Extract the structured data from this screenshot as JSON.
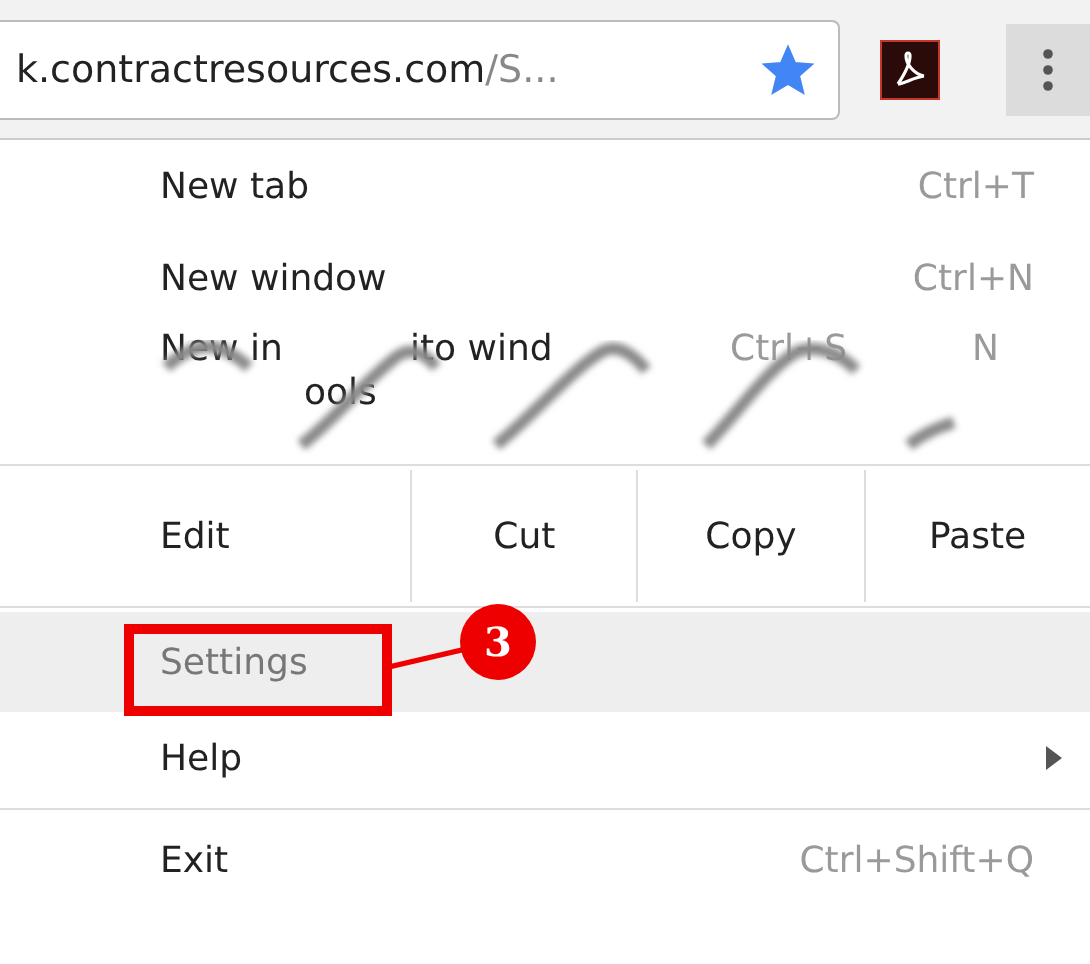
{
  "address_bar": {
    "host": "k.contractresources.com",
    "path": "/S...",
    "bookmarked": true
  },
  "menu": {
    "items": [
      {
        "kind": "item",
        "label": "New tab",
        "shortcut": "Ctrl+T",
        "selected": false,
        "submenu": false,
        "annotated": false
      },
      {
        "kind": "item",
        "label": "New window",
        "shortcut": "Ctrl+N",
        "selected": false,
        "submenu": false,
        "annotated": false
      },
      {
        "kind": "torn",
        "label_parts": [
          "New in",
          "ito wind"
        ],
        "shortcut_parts": [
          "Ctrl+S",
          "N"
        ],
        "peek_text": "ools"
      },
      {
        "kind": "separator"
      },
      {
        "kind": "edit",
        "label": "Edit",
        "actions": [
          "Cut",
          "Copy",
          "Paste"
        ]
      },
      {
        "kind": "separator"
      },
      {
        "kind": "item",
        "label": "Settings",
        "selected": true,
        "submenu": false,
        "annotated": true
      },
      {
        "kind": "item",
        "label": "Help",
        "selected": false,
        "submenu": true,
        "annotated": false
      },
      {
        "kind": "separator"
      },
      {
        "kind": "item",
        "label": "Exit",
        "shortcut": "Ctrl+Shift+Q",
        "selected": false,
        "submenu": false,
        "annotated": false
      }
    ]
  },
  "annotation": {
    "number": "3"
  }
}
